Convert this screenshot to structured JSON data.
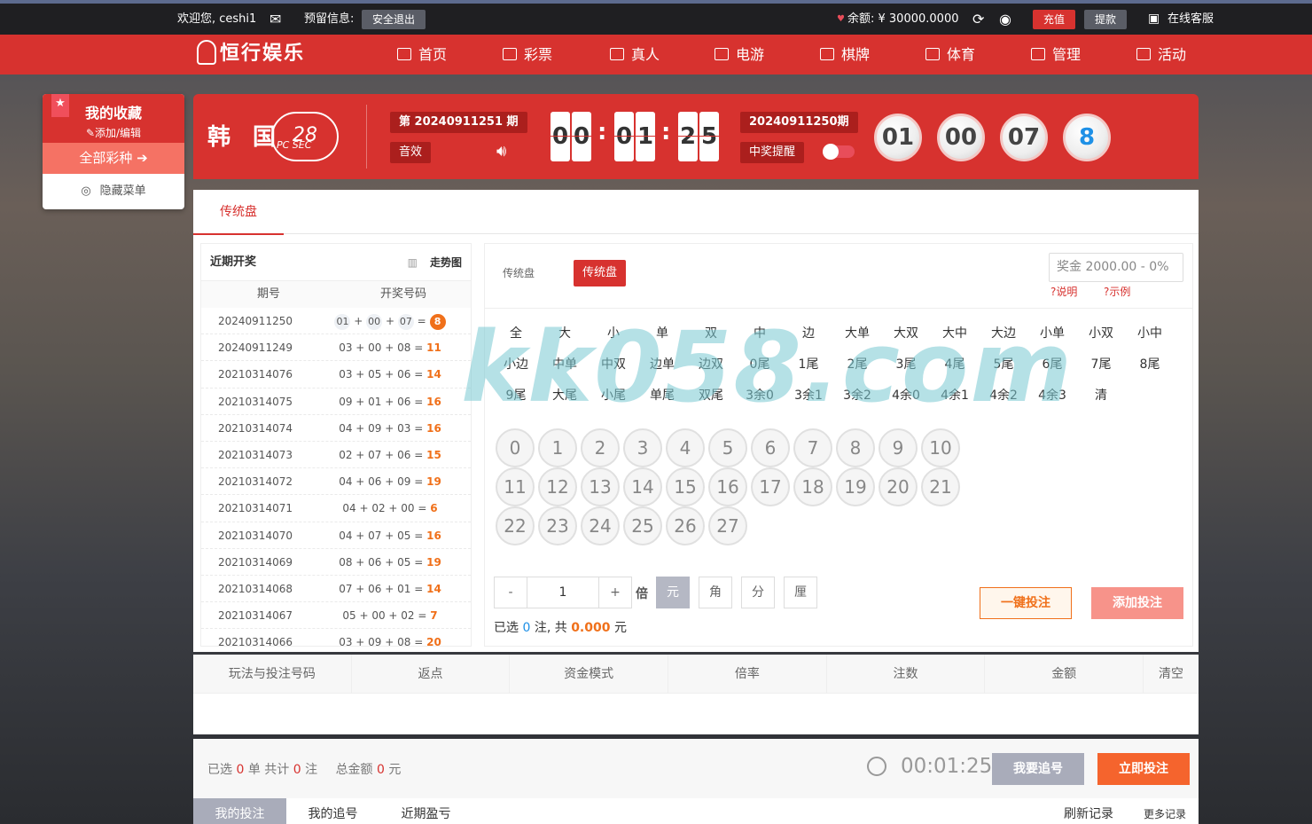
{
  "topbar": {
    "welcome": "欢迎您, ceshi1",
    "reserve": "预留信息:",
    "logout": "安全退出",
    "balance": "余额: ¥ 30000.0000",
    "recharge": "充值",
    "withdraw": "提款",
    "service": "在线客服"
  },
  "nav": {
    "logo": "恒行娱乐",
    "items": [
      "首页",
      "彩票",
      "真人",
      "电游",
      "棋牌",
      "体育",
      "管理",
      "活动"
    ]
  },
  "favorites": {
    "title": "我的收藏",
    "edit": "添加/编辑",
    "all": "全部彩种",
    "hide": "隐藏菜单"
  },
  "lottery": {
    "name": "韩 国",
    "badge": "28",
    "badge_sub": "PC SEC",
    "current_issue": "第 20240911251 期",
    "sound": "音效",
    "countdown": [
      "0",
      "0",
      "0",
      "1",
      "2",
      "5"
    ],
    "last_issue": "20240911250期",
    "win_remind": "中奖提醒",
    "result_balls": [
      "01",
      "00",
      "07",
      "8"
    ]
  },
  "tabs": {
    "traditional": "传统盘"
  },
  "recent": {
    "title": "近期开奖",
    "trend": "走势图",
    "col_issue": "期号",
    "col_numbers": "开奖号码",
    "rows": [
      {
        "issue": "20240911250",
        "a": "01",
        "b": "00",
        "c": "07",
        "sum": "8"
      },
      {
        "issue": "20240911249",
        "a": "03",
        "b": "00",
        "c": "08",
        "sum": "11"
      },
      {
        "issue": "20210314076",
        "a": "03",
        "b": "05",
        "c": "06",
        "sum": "14"
      },
      {
        "issue": "20210314075",
        "a": "09",
        "b": "01",
        "c": "06",
        "sum": "16"
      },
      {
        "issue": "20210314074",
        "a": "04",
        "b": "09",
        "c": "03",
        "sum": "16"
      },
      {
        "issue": "20210314073",
        "a": "02",
        "b": "07",
        "c": "06",
        "sum": "15"
      },
      {
        "issue": "20210314072",
        "a": "04",
        "b": "06",
        "c": "09",
        "sum": "19"
      },
      {
        "issue": "20210314071",
        "a": "04",
        "b": "02",
        "c": "00",
        "sum": "6"
      },
      {
        "issue": "20210314070",
        "a": "04",
        "b": "07",
        "c": "05",
        "sum": "16"
      },
      {
        "issue": "20210314069",
        "a": "08",
        "b": "06",
        "c": "05",
        "sum": "19"
      },
      {
        "issue": "20210314068",
        "a": "07",
        "b": "06",
        "c": "01",
        "sum": "14"
      },
      {
        "issue": "20210314067",
        "a": "05",
        "b": "00",
        "c": "02",
        "sum": "7"
      },
      {
        "issue": "20210314066",
        "a": "03",
        "b": "09",
        "c": "08",
        "sum": "20"
      }
    ]
  },
  "play": {
    "label": "传统盘",
    "button": "传统盘",
    "prize_placeholder": "奖金 2000.00 - 0%",
    "help": "?说明",
    "example": "?示例",
    "options_row1": [
      "全",
      "大",
      "小",
      "单",
      "双",
      "中",
      "边",
      "大单",
      "大双",
      "大中",
      "大边",
      "小单",
      "小双",
      "小中"
    ],
    "options_row2": [
      "小边",
      "中单",
      "中双",
      "边单",
      "边双",
      "0尾",
      "1尾",
      "2尾",
      "3尾",
      "4尾",
      "5尾",
      "6尾",
      "7尾",
      "8尾"
    ],
    "options_row3": [
      "9尾",
      "大尾",
      "小尾",
      "单尾",
      "双尾",
      "3余0",
      "3余1",
      "3余2",
      "4余0",
      "4余1",
      "4余2",
      "4余3",
      "清"
    ],
    "numbers": [
      "0",
      "1",
      "2",
      "3",
      "4",
      "5",
      "6",
      "7",
      "8",
      "9",
      "10",
      "11",
      "12",
      "13",
      "14",
      "15",
      "16",
      "17",
      "18",
      "19",
      "20",
      "21",
      "22",
      "23",
      "24",
      "25",
      "26",
      "27"
    ],
    "minus": "-",
    "multiple": "1",
    "plus": "+",
    "bei": "倍",
    "units": [
      "元",
      "角",
      "分",
      "厘"
    ],
    "selected_prefix": "已选",
    "selected_count": "0",
    "selected_mid": "注, 共",
    "selected_amount": "0.000",
    "selected_suffix": "元",
    "one_key": "一键投注",
    "add_bet": "添加投注"
  },
  "bet_table": {
    "headers": [
      "玩法与投注号码",
      "返点",
      "资金模式",
      "倍率",
      "注数",
      "金额",
      "清空"
    ]
  },
  "summary": {
    "text1": "已选",
    "orders": "0",
    "text2": "单 共计",
    "bets": "0",
    "text3": "注",
    "text4": "总金额",
    "amount": "0",
    "text5": "元",
    "timer": "00:01:25",
    "chase": "我要追号",
    "bet_now": "立即投注"
  },
  "records": {
    "my_bets": "我的投注",
    "my_chase": "我的追号",
    "recent_win": "近期盈亏",
    "refresh": "刷新记录",
    "more": "更多记录"
  },
  "watermark": "kk058.com"
}
